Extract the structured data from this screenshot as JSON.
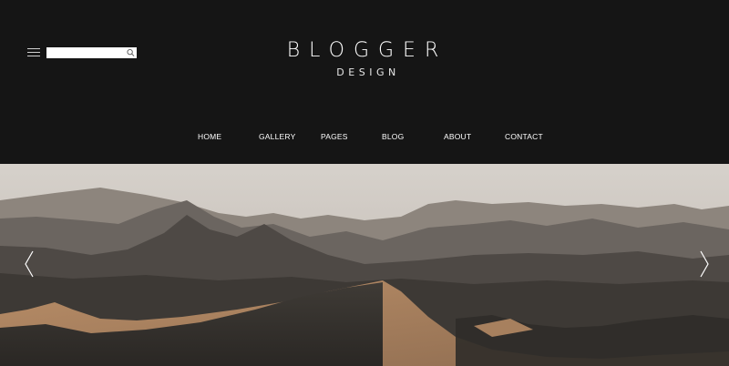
{
  "header": {
    "logo_title": "BLOGGER",
    "logo_subtitle": "DESIGN",
    "search": {
      "placeholder": "",
      "value": ""
    },
    "icons": {
      "menu": "hamburger-menu-icon",
      "search": "search-icon"
    }
  },
  "nav": {
    "items": [
      {
        "label": "HOME"
      },
      {
        "label": "GALLERY"
      },
      {
        "label": "PAGES"
      },
      {
        "label": "BLOG"
      },
      {
        "label": "ABOUT"
      },
      {
        "label": "CONTACT"
      }
    ]
  },
  "hero": {
    "image": "desert-dunes-mountains",
    "icons": {
      "prev": "chevron-left-icon",
      "next": "chevron-right-icon"
    }
  },
  "colors": {
    "header_bg": "#151515",
    "text": "#ffffff",
    "dune_sand": "#a9815e",
    "sky": "#d3cec8"
  }
}
